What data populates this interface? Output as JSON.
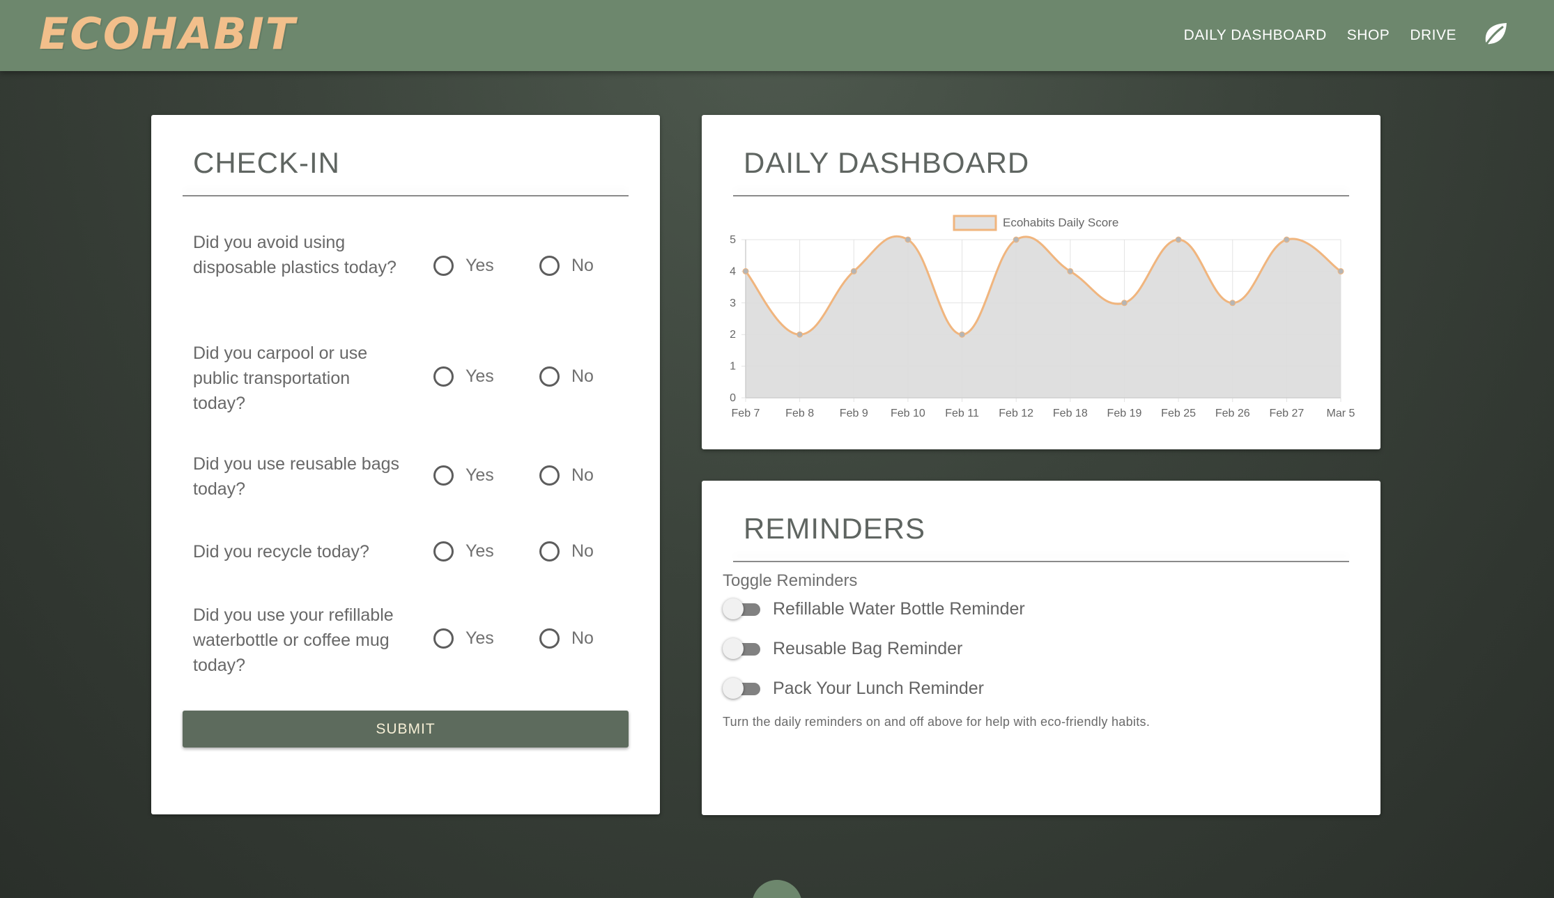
{
  "brand": "ECOHABIT",
  "nav": {
    "links": [
      "DAILY DASHBOARD",
      "SHOP",
      "DRIVE"
    ],
    "icon": "leaf-icon"
  },
  "checkin": {
    "title": "CHECK-IN",
    "questions": [
      {
        "text": "Did you avoid using disposable plastics today?",
        "yes": "Yes",
        "no": "No"
      },
      {
        "text": "Did you carpool or use public transportation today?",
        "yes": "Yes",
        "no": "No"
      },
      {
        "text": "Did you use reusable bags today?",
        "yes": "Yes",
        "no": "No"
      },
      {
        "text": "Did you recycle today?",
        "yes": "Yes",
        "no": "No"
      },
      {
        "text": "Did you use your refillable waterbottle or coffee mug today?",
        "yes": "Yes",
        "no": "No"
      }
    ],
    "submit_label": "SUBMIT"
  },
  "dashboard": {
    "title": "DAILY DASHBOARD"
  },
  "chart_data": {
    "type": "area",
    "title": "",
    "xlabel": "",
    "ylabel": "",
    "x": [
      "Feb 7",
      "Feb 8",
      "Feb 9",
      "Feb 10",
      "Feb 11",
      "Feb 12",
      "Feb 18",
      "Feb 19",
      "Feb 25",
      "Feb 26",
      "Feb 27",
      "Mar 5"
    ],
    "series": [
      {
        "name": "Ecohabits Daily Score",
        "values": [
          4,
          2,
          4,
          5,
          2,
          5,
          4,
          3,
          5,
          3,
          5,
          4
        ]
      }
    ],
    "ylim": [
      0,
      5
    ],
    "yticks": [
      0,
      1,
      2,
      3,
      4,
      5
    ],
    "grid": true,
    "legend": "top-center",
    "colors": {
      "line": "#f0b57e",
      "fill": "#dcdcdc",
      "points": "#b5b5b5"
    }
  },
  "reminders": {
    "title": "REMINDERS",
    "subtitle": "Toggle Reminders",
    "items": [
      {
        "label": "Refillable Water Bottle Reminder",
        "on": false
      },
      {
        "label": "Reusable Bag Reminder",
        "on": false
      },
      {
        "label": "Pack Your Lunch Reminder",
        "on": false
      }
    ],
    "note": "Turn the daily reminders on and off above for help with eco-friendly habits."
  },
  "colors": {
    "navbar": "#6d876d",
    "brand": "#f2bf8b",
    "submit_bg": "#5d6b5d",
    "submit_text": "#f5eed5"
  }
}
